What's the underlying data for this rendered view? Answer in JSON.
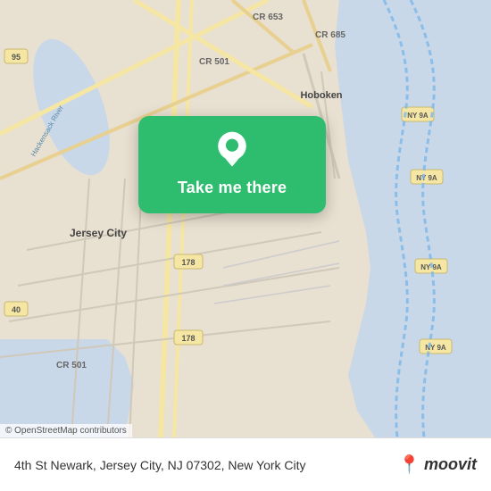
{
  "map": {
    "attribution": "© OpenStreetMap contributors",
    "popup": {
      "button_label": "Take me there"
    }
  },
  "bottom_bar": {
    "address": "4th St Newark, Jersey City, NJ 07302, New York City",
    "logo_brand": "moovit",
    "logo_pin_color": "#e05a2b"
  }
}
